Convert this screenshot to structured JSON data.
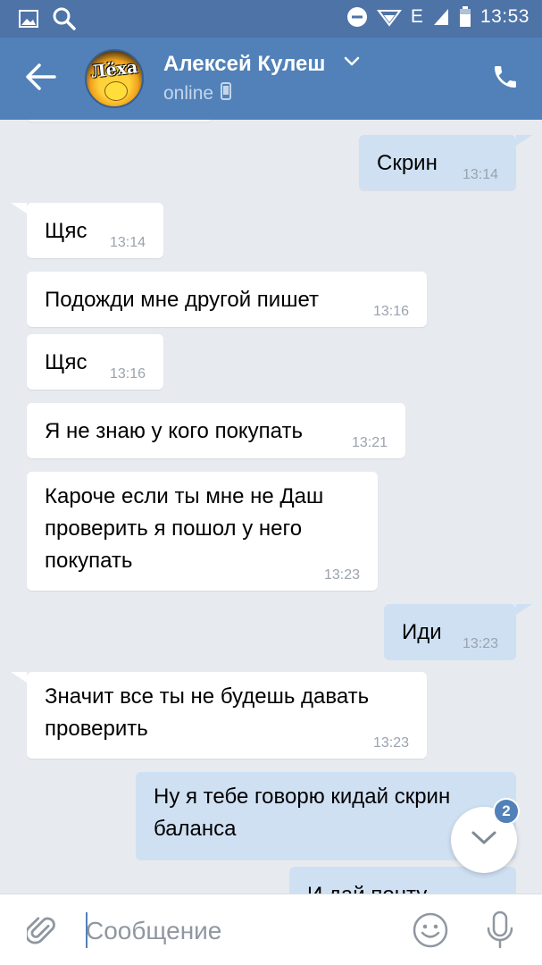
{
  "status_bar": {
    "time": "13:53",
    "network_label": "E",
    "icons": [
      "gallery-icon",
      "search-icon",
      "dnd-icon",
      "wifi-icon",
      "signal-icon",
      "battery-icon"
    ]
  },
  "header": {
    "contact_name": "Алексей Кулеш",
    "status": "online",
    "avatar_text": "Лёха",
    "icons": [
      "back-arrow-icon",
      "chevron-down-icon",
      "mobile-icon",
      "phone-icon"
    ]
  },
  "messages": [
    {
      "dir": "out",
      "text": "Скрин",
      "time": "13:14"
    },
    {
      "dir": "in",
      "text": "Щяс",
      "time": "13:14"
    },
    {
      "dir": "in",
      "text": "Подожди мне другой пишет",
      "time": "13:16"
    },
    {
      "dir": "in",
      "text": "Щяс",
      "time": "13:16"
    },
    {
      "dir": "in",
      "text": "Я не знаю у кого покупать",
      "time": "13:21"
    },
    {
      "dir": "in",
      "text": "Кароче если ты мне не Даш\nпроверить я пошол у него\nпокупать",
      "time": "13:23"
    },
    {
      "dir": "out",
      "text": "Иди",
      "time": "13:23"
    },
    {
      "dir": "in",
      "text": "Значит все ты не будешь давать\nпроверить",
      "time": "13:23"
    },
    {
      "dir": "out",
      "text": "Ну  я тебе говорю кидай скрин\nбаланса",
      "time": ""
    },
    {
      "dir": "out",
      "text": "И дай понту",
      "time": ""
    }
  ],
  "scroll_button": {
    "badge": "2"
  },
  "composer": {
    "placeholder": "Сообщение",
    "value": "",
    "icons": [
      "paperclip-icon",
      "emoji-icon",
      "microphone-icon"
    ]
  },
  "colors": {
    "status_bar": "#4d73a7",
    "header": "#5181b8",
    "background": "#e7ebf0",
    "incoming_bubble": "#ffffff",
    "outgoing_bubble": "#cfe0f3",
    "accent": "#5181b8"
  }
}
